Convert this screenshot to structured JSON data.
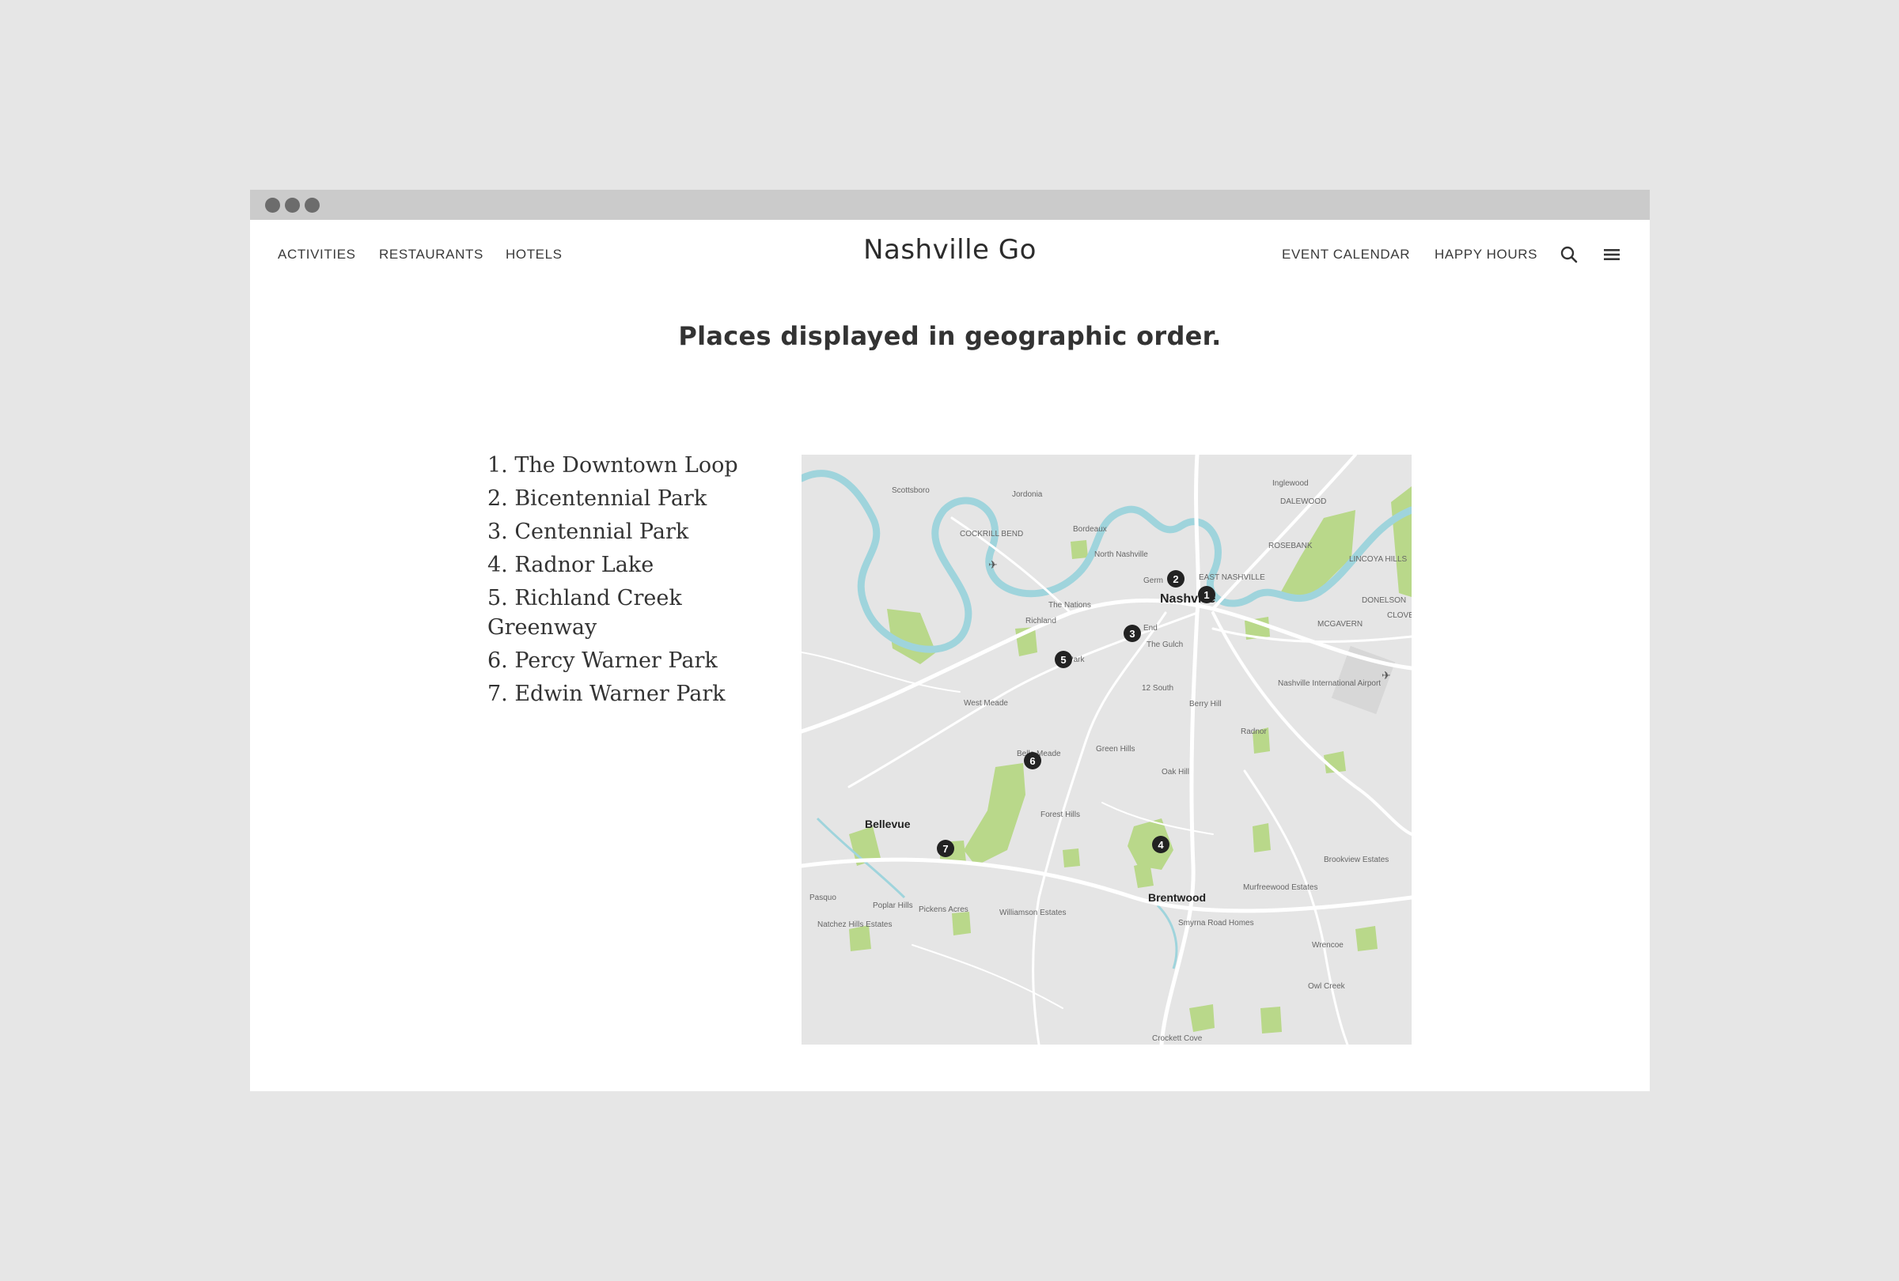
{
  "nav": {
    "left": [
      "ACTIVITIES",
      "RESTAURANTS",
      "HOTELS"
    ],
    "brand": "Nashville Go",
    "right": [
      "EVENT CALENDAR",
      "HAPPY HOURS"
    ],
    "icons": [
      "search-icon",
      "menu-icon"
    ]
  },
  "heading": "Places displayed in geographic order.",
  "places": [
    "1. The Downtown Loop",
    "2. Bicentennial Park",
    "3. Centennial Park",
    "4. Radnor Lake",
    "5. Richland Creek Greenway",
    "6. Percy Warner Park",
    "7. Edwin Warner Park"
  ],
  "map": {
    "labels": {
      "nashville": "Nashville",
      "bellevue": "Bellevue",
      "brentwood": "Brentwood",
      "north_nashville": "North Nashville",
      "the_nations": "The Nations",
      "richland": "Richland",
      "germantown": "Germ",
      "the_gulch": "The Gulch",
      "end": "End",
      "twelve_south": "12 South",
      "berry_hill": "Berry Hill",
      "radnor": "Radnor",
      "green_hills": "Green Hills",
      "oak_hill": "Oak Hill",
      "forest_hills": "Forest Hills",
      "west_meade": "West Meade",
      "belle_meade": "Belle Meade",
      "sylvan_park": "an Park",
      "scottsboro": "Scottsboro",
      "jordonia": "Jordonia",
      "bordeaux": "Bordeaux",
      "cockrill_bend": "COCKRILL BEND",
      "inglewood": "Inglewood",
      "dalewood": "DALEWOOD",
      "rosebank": "ROSEBANK",
      "lincoya_hills": "LINCOYA HILLS",
      "east_nashville": "EAST NASHVILLE",
      "donelson": "DONELSON",
      "mcgavern": "MCGAVERN",
      "clove": "CLOVE",
      "airport": "Nashville International Airport",
      "pasquo": "Pasquo",
      "poplar_hills": "Poplar Hills",
      "pickens_acres": "Pickens Acres",
      "natchez_hills": "Natchez Hills Estates",
      "williamson_estates": "Williamson Estates",
      "smyrna_road_homes": "Smyrna Road Homes",
      "murfreewood_estates": "Murfreewood Estates",
      "brookview_estates": "Brookview Estates",
      "wrencoe": "Wrencoe",
      "owl_creek": "Owl Creek",
      "crockett_cove": "Crockett Cove"
    },
    "pins": [
      "1",
      "2",
      "3",
      "4",
      "5",
      "6",
      "7"
    ],
    "colors": {
      "land": "#e5e5e5",
      "water": "#9fd4dc",
      "park": "#b9d88a",
      "road": "#ffffff",
      "pin": "#222222"
    }
  }
}
